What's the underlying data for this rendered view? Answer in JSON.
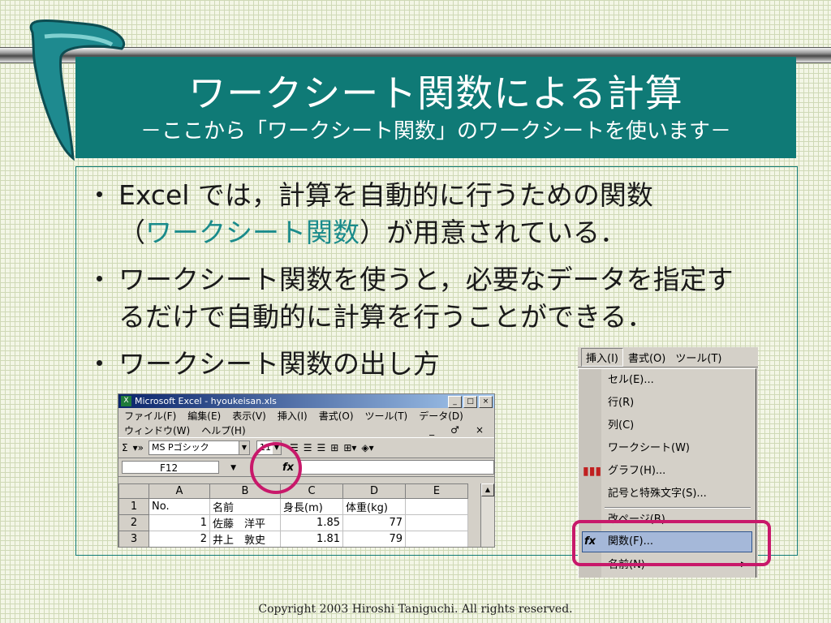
{
  "slide": {
    "title": "ワークシート関数による計算",
    "subtitle": "－ここから「ワークシート関数」のワークシートを使います－",
    "bullet_mark": "・",
    "bullets": [
      {
        "line1": "Excel では，計算を自動的に行うための関数",
        "line2_prefix": "（",
        "line2_highlight": "ワークシート関数",
        "line2_suffix": "）が用意されている．"
      },
      {
        "line1": "ワークシート関数を使うと，必要なデータを指定す",
        "line2": "るだけで自動的に計算を行うことができる．"
      },
      {
        "line1": "ワークシート関数の出し方"
      }
    ],
    "copyright": "Copyright 2003 Hiroshi Taniguchi. All rights reserved.",
    "colors": {
      "title_bg": "#0f7a76",
      "highlight": "#1a8b8b",
      "circle": "#c8186a"
    }
  },
  "excel": {
    "window_title": "Microsoft Excel - hyoukeisan.xls",
    "app_icon": "X",
    "window_buttons": [
      "_",
      "□",
      "×"
    ],
    "menu": [
      "ファイル(F)",
      "編集(E)",
      "表示(V)",
      "挿入(I)",
      "書式(O)",
      "ツール(T)",
      "データ(D)"
    ],
    "menu2": [
      "ウィンドウ(W)",
      "ヘルプ(H)"
    ],
    "mdi_buttons": [
      "_",
      "♂",
      "×"
    ],
    "toolbar": {
      "sigma": "Σ",
      "font": "MS Pゴシック",
      "size": "11"
    },
    "name_box": "F12",
    "fx_label": "fx",
    "columns": [
      "A",
      "B",
      "C",
      "D",
      "E"
    ],
    "rows": [
      {
        "num": "1",
        "cells": [
          "No.",
          "名前",
          "身長(m)",
          "体重(kg)",
          ""
        ]
      },
      {
        "num": "2",
        "cells": [
          "1",
          "佐藤　洋平",
          "1.85",
          "77",
          ""
        ]
      },
      {
        "num": "3",
        "cells": [
          "2",
          "井上　敦史",
          "1.81",
          "79",
          ""
        ]
      }
    ]
  },
  "insert_menu": {
    "menubar": [
      "挿入(I)",
      "書式(O)",
      "ツール(T)"
    ],
    "items": [
      "セル(E)...",
      "行(R)",
      "列(C)",
      "ワークシート(W)",
      "グラフ(H)...",
      "記号と特殊文字(S)...",
      "改ページ(B)",
      "関数(F)...",
      "名前(N)"
    ],
    "selected": "関数(F)...",
    "submenu_arrow": "▶"
  }
}
